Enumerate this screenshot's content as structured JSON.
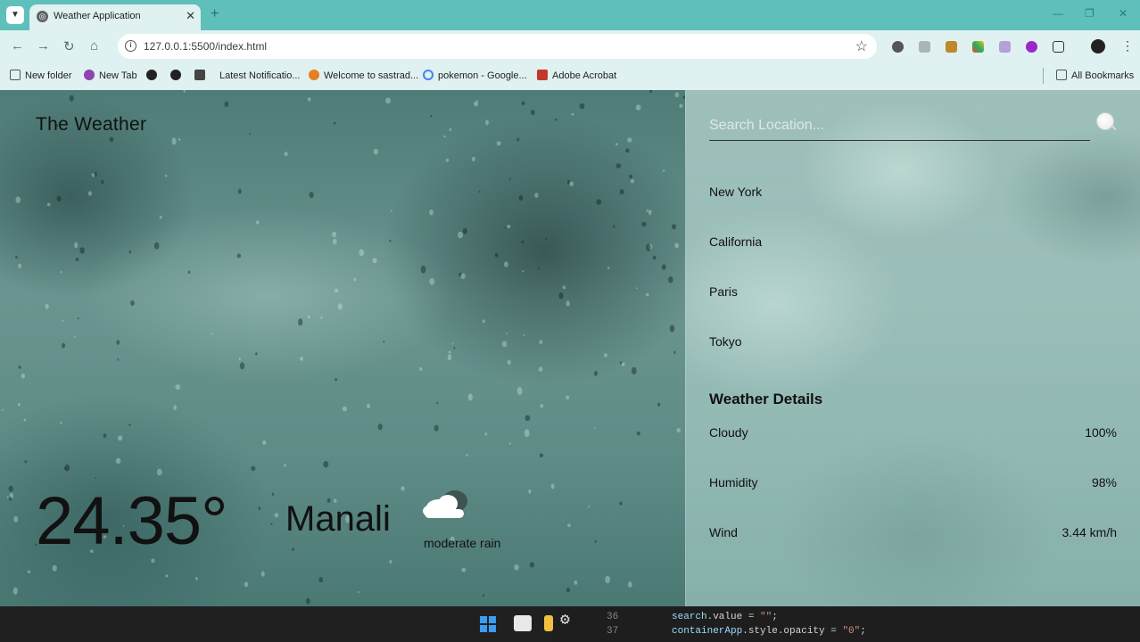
{
  "browser": {
    "tab_title": "Weather Application",
    "url": "127.0.0.1:5500/index.html",
    "new_tab": "+",
    "bookmarks": [
      {
        "label": "New folder",
        "icon": "folder-icon",
        "color": "#555555"
      },
      {
        "label": "New Tab",
        "icon": "tab-icon",
        "color": "#8e44ad"
      },
      {
        "label": "",
        "icon": "globe-icon",
        "color": "#222222"
      },
      {
        "label": "",
        "icon": "globe-icon",
        "color": "#222222"
      },
      {
        "label": "Latest Notificatio...",
        "icon": "notification-icon",
        "color": "#333333"
      },
      {
        "label": "Welcome to sastrad...",
        "icon": "sun-icon",
        "color": "#e67e22"
      },
      {
        "label": "pokemon - Google...",
        "icon": "google-icon",
        "color": "#4285f4"
      },
      {
        "label": "Adobe Acrobat",
        "icon": "acrobat-icon",
        "color": "#c0392b"
      }
    ],
    "all_bookmarks": "All Bookmarks"
  },
  "app": {
    "brand": "The Weather",
    "temperature": "24.35°",
    "city": "Manali",
    "condition": "moderate rain",
    "search_placeholder": "Search Location...",
    "locations": [
      "New York",
      "California",
      "Paris",
      "Tokyo"
    ],
    "details_title": "Weather Details",
    "details": [
      {
        "label": "Cloudy",
        "value": "100%"
      },
      {
        "label": "Humidity",
        "value": "98%"
      },
      {
        "label": "Wind",
        "value": "3.44 km/h"
      }
    ]
  },
  "editor": {
    "lines": [
      {
        "no": "36",
        "var": "search",
        "rest": ".value = ",
        "str": "\"\"",
        "end": ";"
      },
      {
        "no": "37",
        "var": "containerApp",
        "rest": ".style.opacity = ",
        "str": "\"0\"",
        "end": ";"
      }
    ]
  }
}
